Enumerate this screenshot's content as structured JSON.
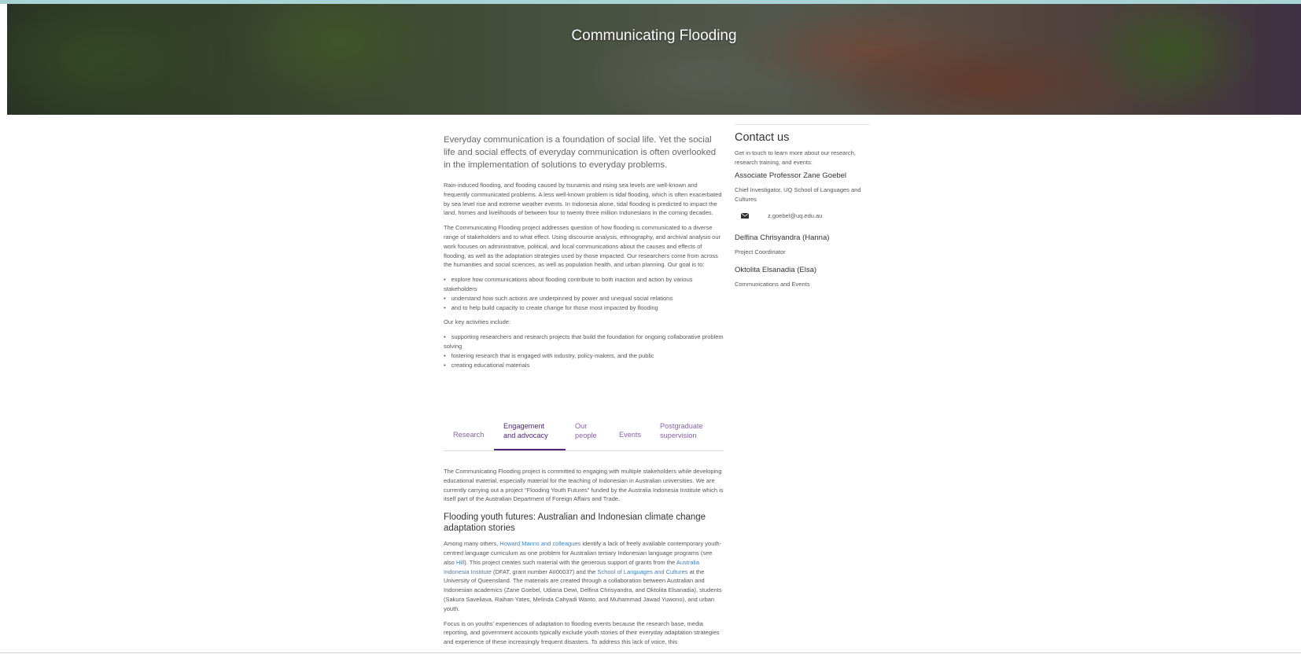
{
  "hero": {
    "title": "Communicating Flooding"
  },
  "intro": {
    "lede": "Everyday communication is a foundation of social life. Yet the social life and social effects of everyday communication is often overlooked in the implementation of solutions to everyday problems.",
    "p1": "Rain-induced flooding, and flooding caused by tsunamis and rising sea levels are well-known and frequently communicated problems. A less well-known problem is tidal flooding, which is often exacerbated by sea level rise and extreme weather events. In Indonesia alone, tidal flooding is predicted to impact the land, homes and livelihoods of between four to twenty three million Indonesians in the coming decades.",
    "p2": "The Communicating Flooding project addresses question of how flooding is communicated to a diverse range of stakeholders and to what effect. Using discourse analysis, ethnography, and archival analysis our work focuses on administrative, political, and local communications about the causes and effects of flooding, as well as the adaptation strategies used by those impacted. Our researchers come from across the humanities and social sciences, as well as population health, and urban planning. Our goal is to:",
    "goals": [
      "explore how communications about flooding contribute to both inaction and action by various stakeholders",
      "understand how such actions are underpinned by power and unequal social relations",
      "and to help build capacity to create change for those most impacted by flooding"
    ],
    "activities_intro": "Our key activities include:",
    "activities": [
      "supporting researchers and research projects that build the foundation for ongoing collaborative problem solving",
      "fostering research that is engaged with industry, policy-makers, and the public",
      "creating educational materials"
    ]
  },
  "tabs": [
    {
      "line1": "Research",
      "line2": ""
    },
    {
      "line1": "Engagement",
      "line2": "and advocacy"
    },
    {
      "line1": "Our",
      "line2": "people"
    },
    {
      "line1": "Events",
      "line2": ""
    },
    {
      "line1": "Postgraduate",
      "line2": "supervision"
    }
  ],
  "engagement": {
    "p1": "The Communicating Flooding project is committed to engaging with multiple stakeholders while developing educational material, especially material for the teaching of Indonesian in Australian universities. We are currently carrying out a project \"Flooding Youth Futures\" funded by the Australia Indonesia Institute which is itself part of the Australian Department of Foreign Affairs and Trade.",
    "heading": "Flooding youth futures: Australian and Indonesian climate change adaptation stories",
    "p2_a": "Among many others, ",
    "p2_link1": "Howard Manns and colleagues",
    "p2_b": " identify a lack of freely available contemporary youth-centred language curriculum as one problem for Australian tertiary Indonesian language programs (see also ",
    "p2_link2": "Hill",
    "p2_c": "). This project creates such material with the generous support of grants from the ",
    "p2_link3": "Australia Indonesia Institute",
    "p2_d": " (DFAT, grant number AII00037) and the ",
    "p2_link4": "School of Languages and Cultures",
    "p2_e": " at the University of Queensland. The materials are created through a collaboration between Australian and Indonesian academics (Zane Goebel, Udiana Dewi, Delfina Chrisyandra, and Oktolita Elsanadia), students (Sakura Saveliava, Raihan Yates, Melinda Cahyadi Wanto, and Muhammad Jawad Yuwono), and urban youth.",
    "p3": "Focus is on youths' experiences of adaptation to flooding events because the research base, media reporting, and government accounts typically exclude youth stories of their everyday adaptation strategies and experience of these increasingly frequent disasters. To address this lack of voice, this"
  },
  "contact": {
    "heading": "Contact us",
    "intro": "Get in touch to learn more about our research, research training, and events:",
    "person1_name": "Associate Professor Zane Goebel",
    "person1_role": "Chief Investigator, UQ School of Languages and Cultures",
    "person1_email": "z.goebel@uq.edu.au",
    "person2_name": "Delfina Chrisyandra (Hanna)",
    "person2_role": "Project Coordinator",
    "person3_name": "Oktolita Elsanadia (Elsa)",
    "person3_role": "Communications and Events",
    "email_icon": "envelope-icon"
  },
  "colors": {
    "accent_purple": "#51247a",
    "tab_purple": "#8b5fa8",
    "link_blue": "#3b82c4"
  }
}
